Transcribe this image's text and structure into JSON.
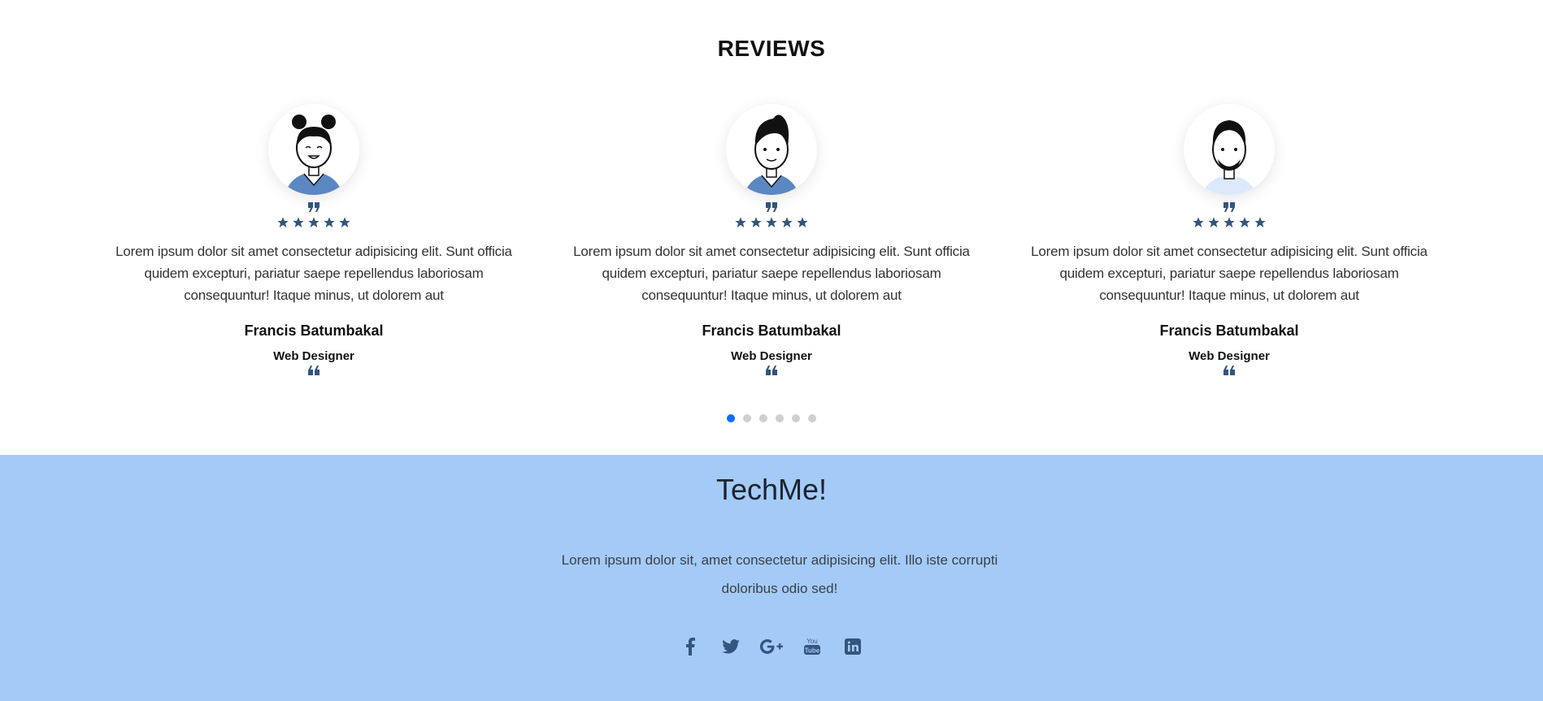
{
  "reviews": {
    "title": "REVIEWS",
    "cards": [
      {
        "avatar": "female-avatar-illustration",
        "rating": 5,
        "text": "Lorem ipsum dolor sit amet consectetur adipisicing elit. Sunt officia quidem excepturi, pariatur saepe repellendus laboriosam consequuntur! Itaque minus, ut dolorem aut",
        "name": "Francis Batumbakal",
        "role": "Web Designer"
      },
      {
        "avatar": "male-avatar-illustration",
        "rating": 5,
        "text": "Lorem ipsum dolor sit amet consectetur adipisicing elit. Sunt officia quidem excepturi, pariatur saepe repellendus laboriosam consequuntur! Itaque minus, ut dolorem aut",
        "name": "Francis Batumbakal",
        "role": "Web Designer"
      },
      {
        "avatar": "bearded-male-avatar-illustration",
        "rating": 5,
        "text": "Lorem ipsum dolor sit amet consectetur adipisicing elit. Sunt officia quidem excepturi, pariatur saepe repellendus laboriosam consequuntur! Itaque minus, ut dolorem aut",
        "name": "Francis Batumbakal",
        "role": "Web Designer"
      }
    ],
    "carousel": {
      "total_pages": 6,
      "active_page": 1
    }
  },
  "footer": {
    "brand": "TechMe!",
    "tagline": "Lorem ipsum dolor sit, amet consectetur adipisicing elit. Illo iste corrupti doloribus odio sed!",
    "socials": [
      "facebook-icon",
      "twitter-icon",
      "google-plus-icon",
      "youtube-icon",
      "linkedin-icon"
    ]
  },
  "colors": {
    "accent": "#0d6efd",
    "icon": "#34557d",
    "footer_bg": "#a4cbf7"
  }
}
